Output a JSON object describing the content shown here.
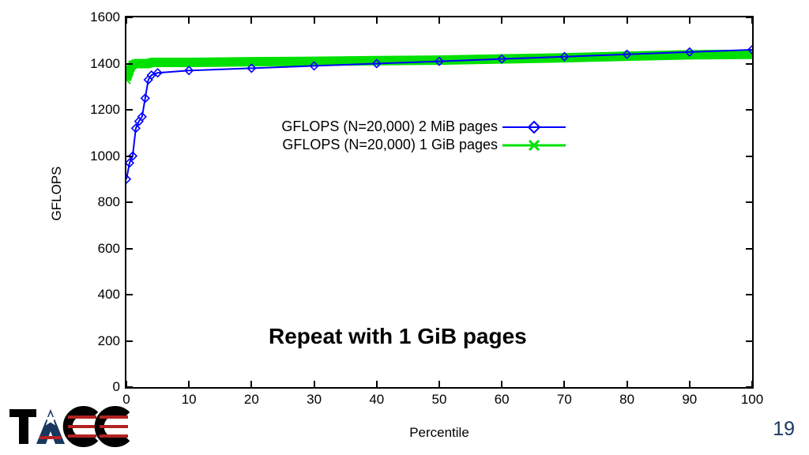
{
  "chart_data": {
    "type": "line",
    "xlabel": "Percentile",
    "ylabel": "GFLOPS",
    "xlim": [
      0,
      100
    ],
    "ylim": [
      0,
      1600
    ],
    "xticks": [
      0,
      10,
      20,
      30,
      40,
      50,
      60,
      70,
      80,
      90,
      100
    ],
    "yticks": [
      0,
      200,
      400,
      600,
      800,
      1000,
      1200,
      1400,
      1600
    ],
    "caption": "Repeat with 1 GiB pages",
    "legend_position": "inside-upper-center",
    "series": [
      {
        "name": "GFLOPS (N=20,000) 2 MiB pages",
        "color": "#0000ff",
        "marker": "diamond",
        "x": [
          0.0,
          0.5,
          1.0,
          1.5,
          2.0,
          2.5,
          3.0,
          3.5,
          4.0,
          5,
          10,
          20,
          30,
          40,
          50,
          60,
          70,
          80,
          90,
          100
        ],
        "y": [
          900,
          970,
          1000,
          1120,
          1150,
          1170,
          1250,
          1330,
          1350,
          1360,
          1370,
          1380,
          1390,
          1400,
          1410,
          1420,
          1430,
          1440,
          1450,
          1460
        ]
      },
      {
        "name": "GFLOPS (N=20,000) 1 GiB pages",
        "color": "#00e000",
        "marker": "x",
        "x": [
          0.0,
          0.5,
          1.0,
          1.5,
          2.0,
          2.5,
          3.0,
          3.5,
          4.0,
          5,
          10,
          20,
          30,
          40,
          50,
          60,
          70,
          80,
          90,
          100
        ],
        "y": [
          1330,
          1370,
          1395,
          1400,
          1400,
          1400,
          1400,
          1400,
          1405,
          1405,
          1405,
          1408,
          1410,
          1413,
          1415,
          1420,
          1425,
          1432,
          1438,
          1440
        ]
      }
    ]
  },
  "page_number": "19",
  "logo_text": "TACC"
}
